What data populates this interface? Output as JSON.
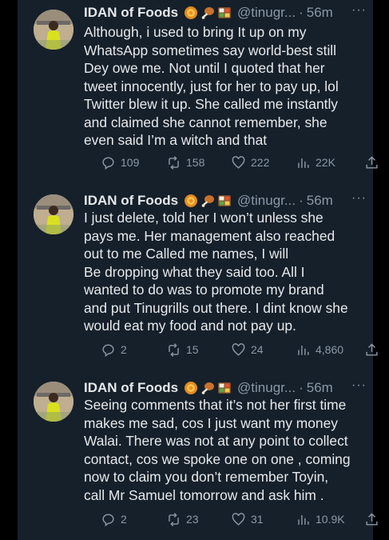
{
  "tweets": [
    {
      "name": "IDAN of Foods",
      "handle": "@tinugr...",
      "separator": "·",
      "time": "56m",
      "emojis": [
        "cooking-emoji",
        "poultry-leg-emoji",
        "bento-emoji"
      ],
      "lines": [
        "Although, i used to bring It up on my",
        "WhatsApp sometimes say world-best still",
        "Dey owe me. Not until I quoted that her",
        "tweet innocently, just for her to pay up, lol",
        "Twitter blew it up. She called me instantly",
        "and claimed she cannot remember, she",
        "even said I’m a witch and that"
      ],
      "replies": "109",
      "reposts": "158",
      "likes": "222",
      "views": "22K"
    },
    {
      "name": "IDAN of Foods",
      "handle": "@tinugr...",
      "separator": "·",
      "time": "56m",
      "emojis": [
        "cooking-emoji",
        "poultry-leg-emoji",
        "bento-emoji"
      ],
      "lines": [
        "I just delete, told her I won’t unless she",
        "pays me. Her management also reached",
        "out to me Called me names, I will",
        "Be dropping what they said too. All I",
        "wanted to do was to promote my brand",
        "and put Tinugrills out there. I dint know she",
        "would eat my food and not pay up."
      ],
      "replies": "2",
      "reposts": "15",
      "likes": "24",
      "views": "4,860"
    },
    {
      "name": "IDAN of Foods",
      "handle": "@tinugr...",
      "separator": "·",
      "time": "56m",
      "emojis": [
        "cooking-emoji",
        "poultry-leg-emoji",
        "bento-emoji"
      ],
      "lines": [
        "Seeing comments that it’s not her first time",
        "makes me sad, cos I just want my money",
        "Walai. There was not at any point to collect",
        "contact, cos we spoke one on one , coming",
        "now to claim you don’t remember Toyin,",
        "call Mr Samuel tomorrow and ask him ."
      ],
      "replies": "2",
      "reposts": "23",
      "likes": "31",
      "views": "10.9K"
    }
  ],
  "more_label": "···",
  "colors": {
    "background": "#15202b",
    "text": "#e7e9ea",
    "muted": "#8b98a5"
  }
}
